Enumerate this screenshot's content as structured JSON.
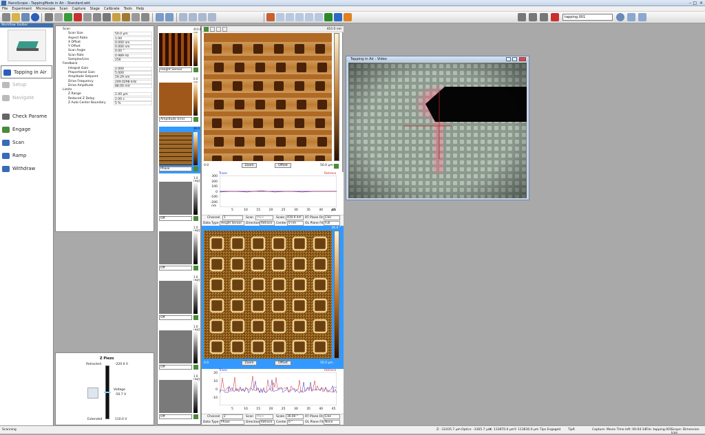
{
  "window": {
    "title": "NanoScope - TappingMode in Air - Standard.wkt"
  },
  "menu": [
    "File",
    "Experiment",
    "Microscope",
    "Scan",
    "Capture",
    "Stage",
    "Calibrate",
    "Tools",
    "Help"
  ],
  "toolbar": {
    "search_value": "tapping.001"
  },
  "workflow": {
    "header": "Workflow Toolbar",
    "items": [
      {
        "label": "Tapping in Air",
        "icon": "chevron-icon"
      },
      {
        "label": "Setup",
        "icon": "setup-icon"
      },
      {
        "label": "Navigate",
        "icon": "navigate-icon"
      },
      {
        "label": "Check Parame",
        "icon": "check-icon"
      },
      {
        "label": "Engage",
        "icon": "engage-icon"
      },
      {
        "label": "Scan",
        "icon": "scan-icon"
      },
      {
        "label": "Ramp",
        "icon": "ramp-icon"
      },
      {
        "label": "Withdraw",
        "icon": "withdraw-icon"
      }
    ]
  },
  "params": [
    {
      "k": "Scan",
      "v": "",
      "lvl": 0
    },
    {
      "k": "Scan Size",
      "v": "50.0 µm",
      "lvl": 1
    },
    {
      "k": "Aspect Ratio",
      "v": "1.00",
      "lvl": 1
    },
    {
      "k": "X Offset",
      "v": "0.000 nm",
      "lvl": 1
    },
    {
      "k": "Y Offset",
      "v": "0.000 nm",
      "lvl": 1
    },
    {
      "k": "Scan Angle",
      "v": "0.00 °",
      "lvl": 1
    },
    {
      "k": "Scan Rate",
      "v": "0.989 Hz",
      "lvl": 1
    },
    {
      "k": "Samples/Line",
      "v": "256",
      "lvl": 1
    },
    {
      "k": "Feedback",
      "v": "",
      "lvl": 0
    },
    {
      "k": "Integral Gain",
      "v": "2.000",
      "lvl": 1
    },
    {
      "k": "Proportional Gain",
      "v": "5.000",
      "lvl": 1
    },
    {
      "k": "Amplitude Setpoint",
      "v": "19.29 nm",
      "lvl": 1
    },
    {
      "k": "Drive Frequency",
      "v": "249.0298 kHz",
      "lvl": 1
    },
    {
      "k": "Drive Amplitude",
      "v": "88.00 mV",
      "lvl": 1
    },
    {
      "k": "Limits",
      "v": "",
      "lvl": 0
    },
    {
      "k": "Z Range",
      "v": "1.00 µm",
      "lvl": 1
    },
    {
      "k": "Reduced Z Delay",
      "v": "2.00 s",
      "lvl": 1
    },
    {
      "k": "Z Auto Center Boundary",
      "v": "5 %",
      "lvl": 1
    }
  ],
  "zpiezo": {
    "title": "Z Piezo",
    "retracted": "Retracted",
    "extended": "Extended",
    "top_v": "-220.0 V",
    "bottom_v": "110.0 V",
    "voltage_label": "Voltage",
    "voltage": "-50.7 V"
  },
  "channels": [
    {
      "top": "410.0 nm",
      "select": "Height Sensor",
      "active": false,
      "has_image": true,
      "kind": "height"
    },
    {
      "top": "0.0 nm",
      "select": "Amplitude Error",
      "active": false,
      "has_image": true,
      "kind": "amp"
    },
    {
      "top": "36.0 °",
      "select": "Phase",
      "active": true,
      "has_image": true,
      "kind": "phase"
    },
    {
      "top": "1.0 UNIT",
      "select": "Off",
      "active": false,
      "has_image": false
    },
    {
      "top": "1.0 UNIT",
      "select": "Off",
      "active": false,
      "has_image": false
    },
    {
      "top": "1.0 UNIT",
      "select": "Off",
      "active": false,
      "has_image": false
    },
    {
      "top": "1.0 UNIT",
      "select": "Off",
      "active": false,
      "has_image": false
    },
    {
      "top": "1.0 UNIT",
      "select": "Off",
      "active": false,
      "has_image": false
    }
  ],
  "view1": {
    "scale_top": "410.0 nm",
    "left_label": "0.0",
    "right_label": "50.0 µm",
    "zoom": "Zoom",
    "offset": "Offset",
    "plot": {
      "trace": "Trace",
      "retrace": "Retrace",
      "unit": "nm",
      "xunit": "µm",
      "yticks": [
        "300",
        "200",
        "100",
        "0",
        "-100",
        "-200"
      ],
      "xticks": [
        "5",
        "10",
        "15",
        "20",
        "25",
        "30",
        "35",
        "40",
        "45"
      ]
    },
    "ctrl": {
      "channel_label": "Channel",
      "channel": "1",
      "scan_label": "Scan",
      "scan": "Main",
      "scale_label": "Scale",
      "scale": "410.0 nm",
      "rtplane_label": "RT Plane Fit",
      "rtplane": "Line",
      "datatype_label": "Data Type",
      "datatype": "Height Sensor",
      "direction_label": "Direction",
      "direction": "Retrace",
      "center_label": "Center",
      "center": "0 nm",
      "olplane_label": "OL Plane Fit",
      "olplane": "Full"
    }
  },
  "view2": {
    "scale_top": "36.0 °",
    "left_label": "0.0",
    "right_label": "50.0 µm",
    "zoom": "Zoom",
    "offset": "Offset",
    "plot": {
      "trace": "Trace",
      "retrace": "Retrace",
      "yticks": [
        "20",
        "10",
        "0",
        "-10"
      ],
      "xticks": [
        "5",
        "10",
        "15",
        "20",
        "25",
        "30",
        "35",
        "40",
        "45"
      ]
    },
    "ctrl": {
      "channel_label": "Channel",
      "channel": "2",
      "scan_label": "Scan",
      "scan": "Main",
      "scale_label": "Scale",
      "scale": "36.00 °",
      "rtplane_label": "RT Plane Fit",
      "rtplane": "Line",
      "datatype_label": "Data Type",
      "datatype": "Phase",
      "direction_label": "Direction",
      "direction": "Retrace",
      "center_label": "Center",
      "center": "0 °",
      "olplane_label": "OL Plane Fit",
      "olplane": "None"
    }
  },
  "video": {
    "title": "Tapping in Air : Video"
  },
  "status": {
    "left": "Scanning",
    "z": "Z: -12435.7 µm",
    "optics": "Optics: -3365.7 µm",
    "x": "X: 1336T0.0 µm",
    "y": "Y: 113630.0 µm",
    "tip": "Tips Engaged",
    "tipr": "TipR",
    "capture": "Capture: Movie Time left: 00:04:14",
    "file": "File: tapping.001",
    "scope": "Scope: Dimension Icon"
  },
  "colors": {
    "accent": "#3e6fae",
    "height_dark": "#4a2208",
    "height_light": "#e5b97a",
    "phase_bg": "#8a5a1a",
    "trace": "#2a2acc",
    "retrace": "#cc2222",
    "selection": "#3399ff"
  }
}
